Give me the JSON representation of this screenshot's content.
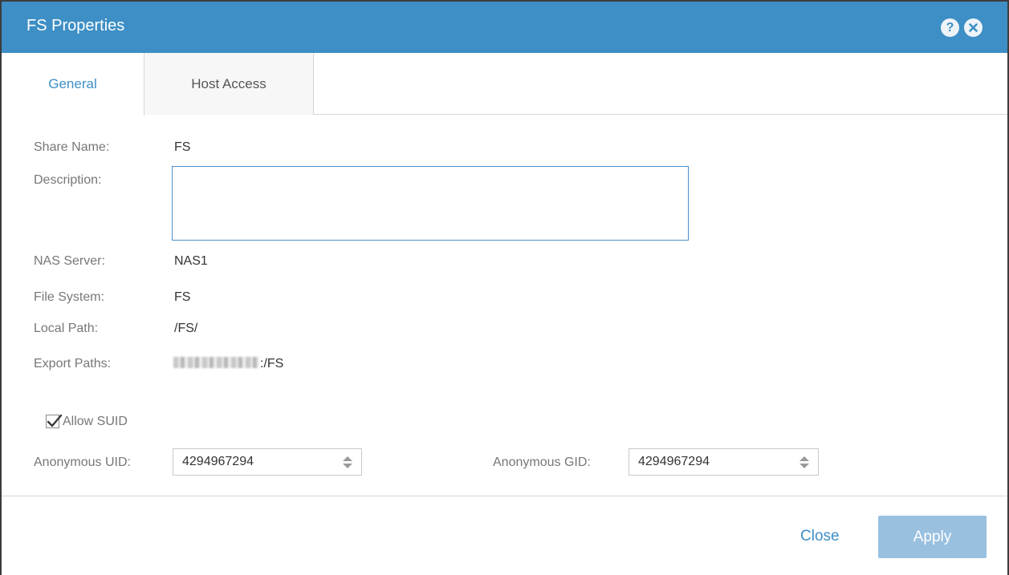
{
  "dialog": {
    "title": "FS Properties",
    "help_icon": "?"
  },
  "tabs": [
    {
      "label": "General",
      "active": true
    },
    {
      "label": "Host Access",
      "active": false
    }
  ],
  "general": {
    "share_name_label": "Share Name:",
    "share_name_value": "FS",
    "description_label": "Description:",
    "description_value": "",
    "nas_server_label": "NAS Server:",
    "nas_server_value": "NAS1",
    "file_system_label": "File System:",
    "file_system_value": "FS",
    "local_path_label": "Local Path:",
    "local_path_value": "/FS/",
    "export_paths_label": "Export Paths:",
    "export_paths_suffix": ":/FS",
    "allow_suid_label": "Allow SUID",
    "allow_suid_checked": true,
    "anonymous_uid_label": "Anonymous UID:",
    "anonymous_uid_value": "4294967294",
    "anonymous_gid_label": "Anonymous GID:",
    "anonymous_gid_value": "4294967294"
  },
  "footer": {
    "close_label": "Close",
    "apply_label": "Apply"
  },
  "colors": {
    "accent": "#3d8fc5",
    "apply_disabled": "#9ac0e0"
  },
  "icons": {
    "help": "help-icon",
    "close": "close-icon",
    "check": "checkmark-icon",
    "spinner": "up-down-arrows-icon"
  }
}
